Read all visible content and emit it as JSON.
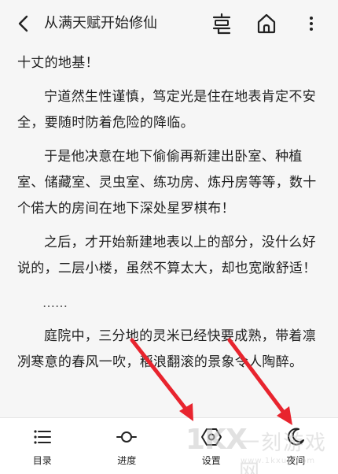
{
  "header": {
    "title": "从满天赋开始修仙",
    "back_icon": "chevron-left-icon",
    "chapter_icon": "chapter-list-icon",
    "home_icon": "home-icon",
    "more_icon": "more-icon"
  },
  "content": {
    "paragraphs": [
      "十丈的地基！",
      "宁道然生性谨慎，笃定光是住在地表肯定不安全，要随时防着危险的降临。",
      "于是他决意在地下偷偷再新建出卧室、种植室、储藏室、灵虫室、练功房、炼丹房等等，数十个偌大的房间在地下深处星罗棋布！",
      "之后，才开始新建地表以上的部分，没什么好说的，二层小楼，虽然不算太大，却也宽敞舒适！",
      "……",
      "庭院中，三分地的灵米已经快要成熟，带着凛冽寒意的春风一吹，稻浪翻滚的景象令人陶醉。"
    ]
  },
  "toolbar": {
    "items": [
      {
        "label": "目录",
        "icon": "menu-list-icon"
      },
      {
        "label": "进度",
        "icon": "progress-slider-icon"
      },
      {
        "label": "设置",
        "icon": "settings-hexagon-icon"
      },
      {
        "label": "夜间",
        "icon": "moon-icon"
      }
    ]
  },
  "watermark": {
    "logo": "1KX",
    "text": "一刻游戏网",
    "url": "www.1kxun.com"
  },
  "colors": {
    "background": "#f6f6f6",
    "toolbar_bg": "#ffffff",
    "text": "#202020",
    "annotation_arrow": "#e8242e"
  }
}
